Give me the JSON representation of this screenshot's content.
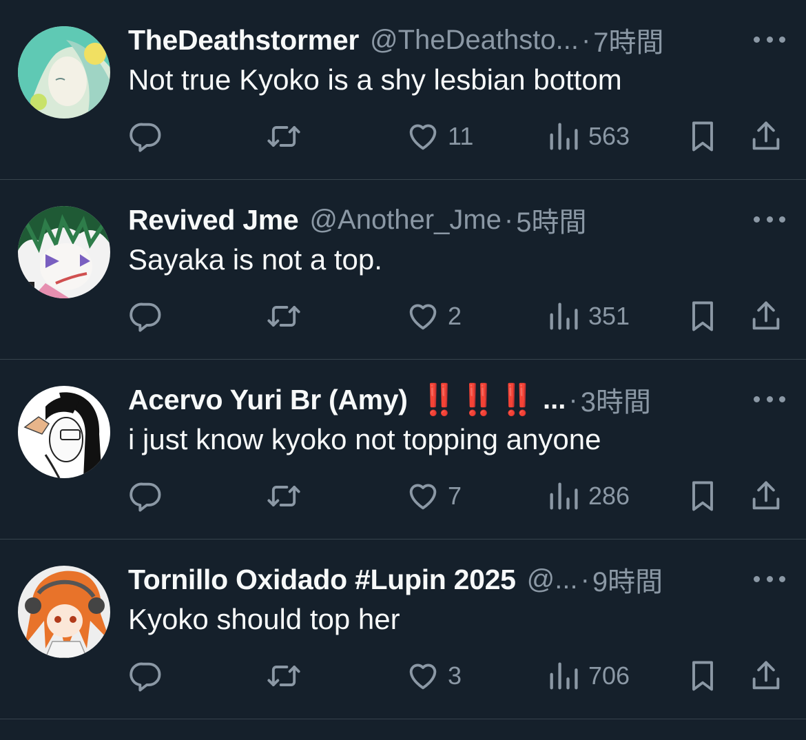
{
  "replies": [
    {
      "name": "TheDeathstormer",
      "handle": "@TheDeathsto...",
      "time": "7時間",
      "text": "Not true Kyoko is a shy lesbian bottom",
      "likes": "11",
      "views": "563",
      "avatar_icon": "teal-haired-character-avatar"
    },
    {
      "name": "Revived Jme",
      "handle": "@Another_Jme",
      "time": "5時間",
      "text": "Sayaka is not a top.",
      "likes": "2",
      "views": "351",
      "avatar_icon": "green-haired-character-avatar"
    },
    {
      "name": "Acervo Yuri Br (Amy)",
      "name_emoji": "‼️‼️‼️",
      "name_ellipsis": "...",
      "time": "3時間",
      "text": "i just know kyoko not topping anyone",
      "likes": "7",
      "views": "286",
      "avatar_icon": "black-white-manga-character-avatar"
    },
    {
      "name": "Tornillo Oxidado #Lupin 2025",
      "handle": "@...",
      "time": "9時間",
      "text": "Kyoko should top her",
      "likes": "3",
      "views": "706",
      "avatar_icon": "orange-haired-character-avatar"
    }
  ],
  "icons": {
    "reply": "reply-icon",
    "retweet": "retweet-icon",
    "like": "heart-icon",
    "views": "views-chart-icon",
    "bookmark": "bookmark-icon",
    "share": "share-icon",
    "more": "more-icon"
  },
  "colors": {
    "background": "#15202b",
    "text": "#f7f9f9",
    "secondary": "#8b98a5",
    "divider": "#38444d",
    "emoji_red": "#e0172d"
  }
}
